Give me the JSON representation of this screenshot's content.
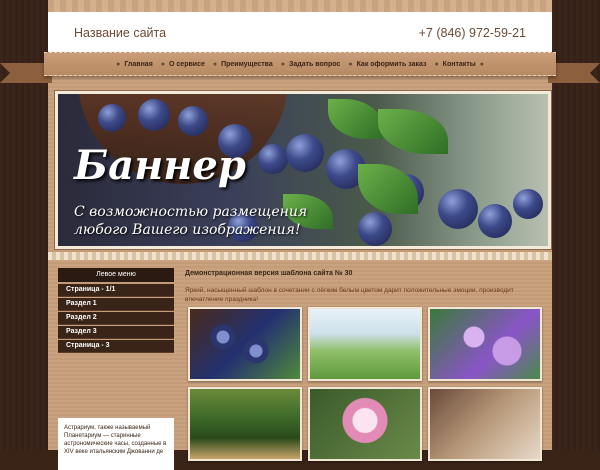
{
  "header": {
    "site_name": "Название сайта",
    "phone": "+7 (846) 972-59-21"
  },
  "nav": {
    "items": [
      "Главная",
      "О сервисе",
      "Преимущества",
      "Задать вопрос",
      "Как оформить заказ",
      "Контакты"
    ]
  },
  "banner": {
    "title": "Баннер",
    "subtitle_line1": "С возможностью размещения",
    "subtitle_line2": "любого Вашего изображения!"
  },
  "sidebar": {
    "heading": "Левое меню",
    "items": [
      "Страница - 1/1",
      "Раздел 1",
      "Раздел 2",
      "Раздел 3",
      "Страница - 3"
    ],
    "text": "Астрариум, также называемый Планетариум — старинные астрономические часы, созданные в XIV веке итальянским Джованни де"
  },
  "main": {
    "title": "Демонстрационная версия шаблона сайта № 30",
    "text": "Яркий, насыщенный шаблон в сочетании с лёгким белым цветом дарит положительные эмоции, производит впечатление праздника!"
  }
}
